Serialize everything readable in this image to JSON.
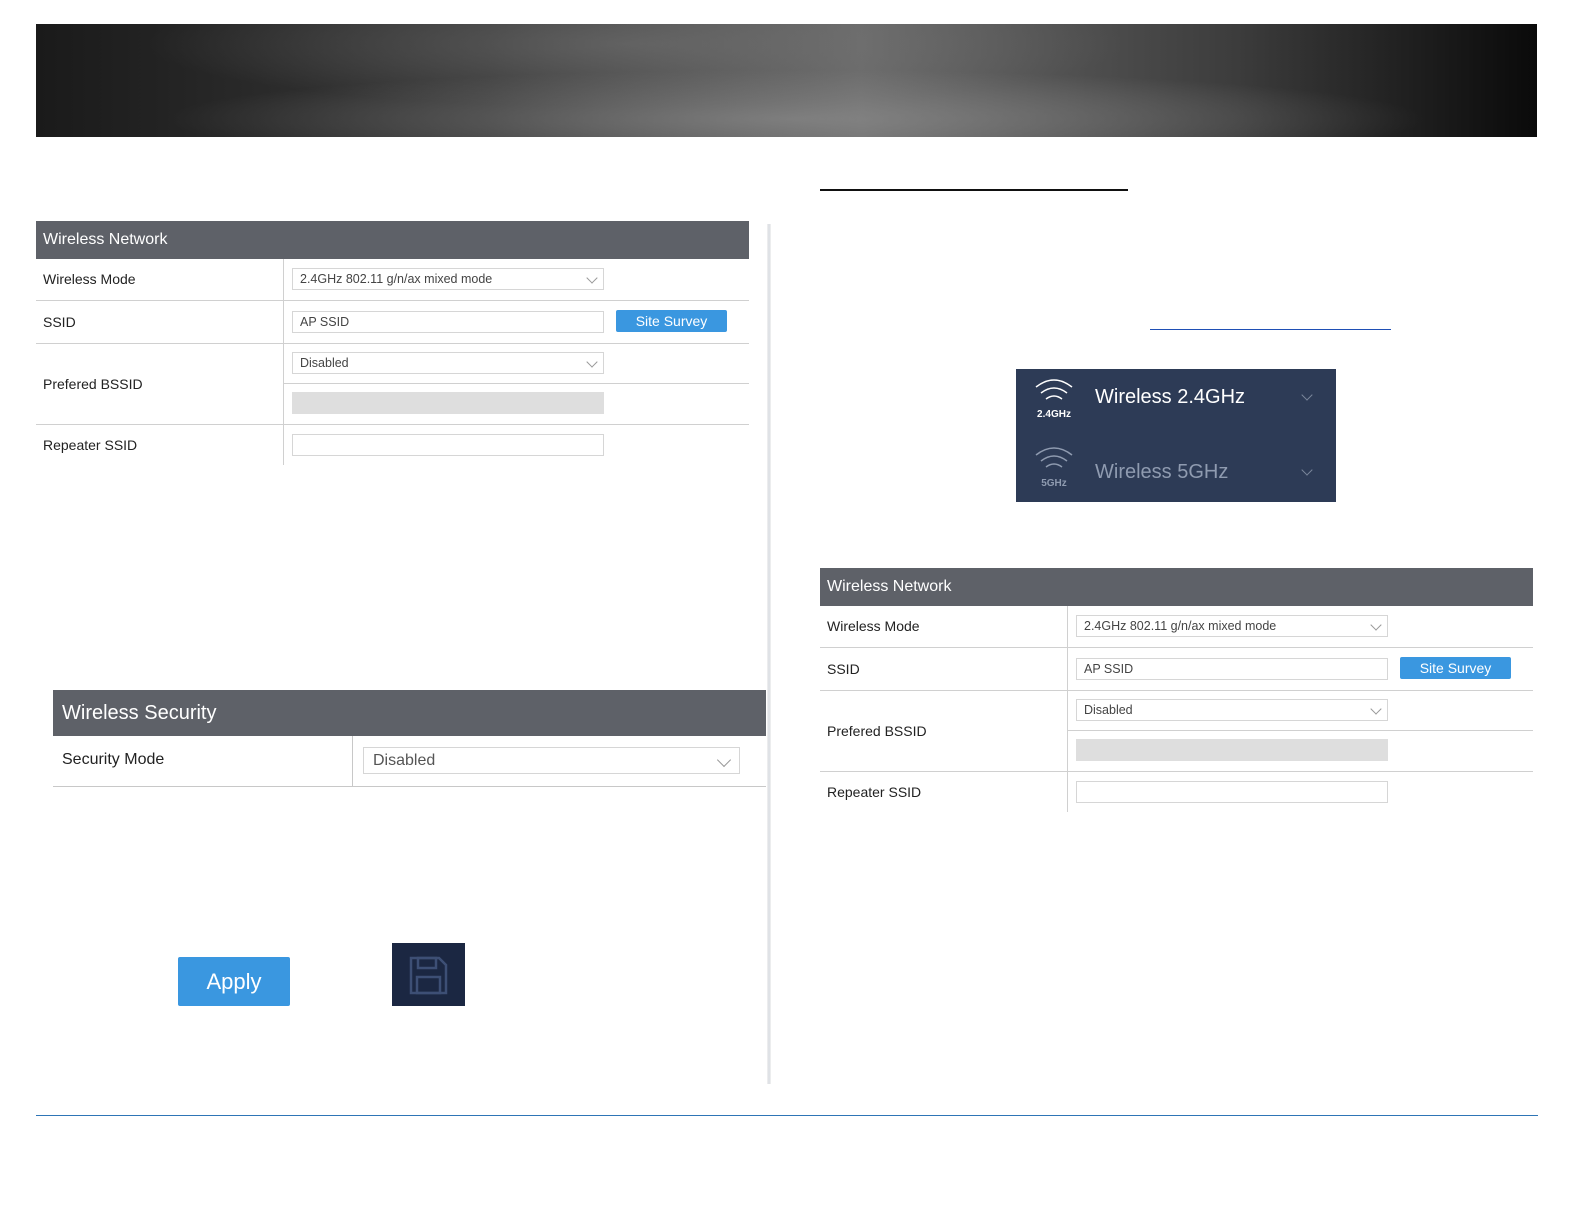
{
  "left_network": {
    "header": "Wireless Network",
    "mode_label": "Wireless Mode",
    "mode_value": "2.4GHz 802.11 g/n/ax mixed mode",
    "ssid_label": "SSID",
    "ssid_value": "AP SSID",
    "site_survey": "Site Survey",
    "bssid_label": "Prefered BSSID",
    "bssid_value": "Disabled",
    "repeater_label": "Repeater SSID"
  },
  "security": {
    "header": "Wireless Security",
    "mode_label": "Security Mode",
    "mode_value": "Disabled"
  },
  "buttons": {
    "apply": "Apply"
  },
  "band_menu": {
    "items": [
      {
        "label": "Wireless 2.4GHz",
        "badge": "2.4GHz"
      },
      {
        "label": "Wireless 5GHz",
        "badge": "5GHz"
      }
    ]
  },
  "right_network": {
    "header": "Wireless Network",
    "mode_label": "Wireless Mode",
    "mode_value": "2.4GHz 802.11 g/n/ax mixed mode",
    "ssid_label": "SSID",
    "ssid_value": "AP SSID",
    "site_survey": "Site Survey",
    "bssid_label": "Prefered BSSID",
    "bssid_value": "Disabled",
    "repeater_label": "Repeater SSID"
  },
  "colors": {
    "header_bg": "#5e6168",
    "button_blue": "#3a97e0",
    "menu_bg": "#2d3b56",
    "footer_rule": "#2e75b6"
  }
}
